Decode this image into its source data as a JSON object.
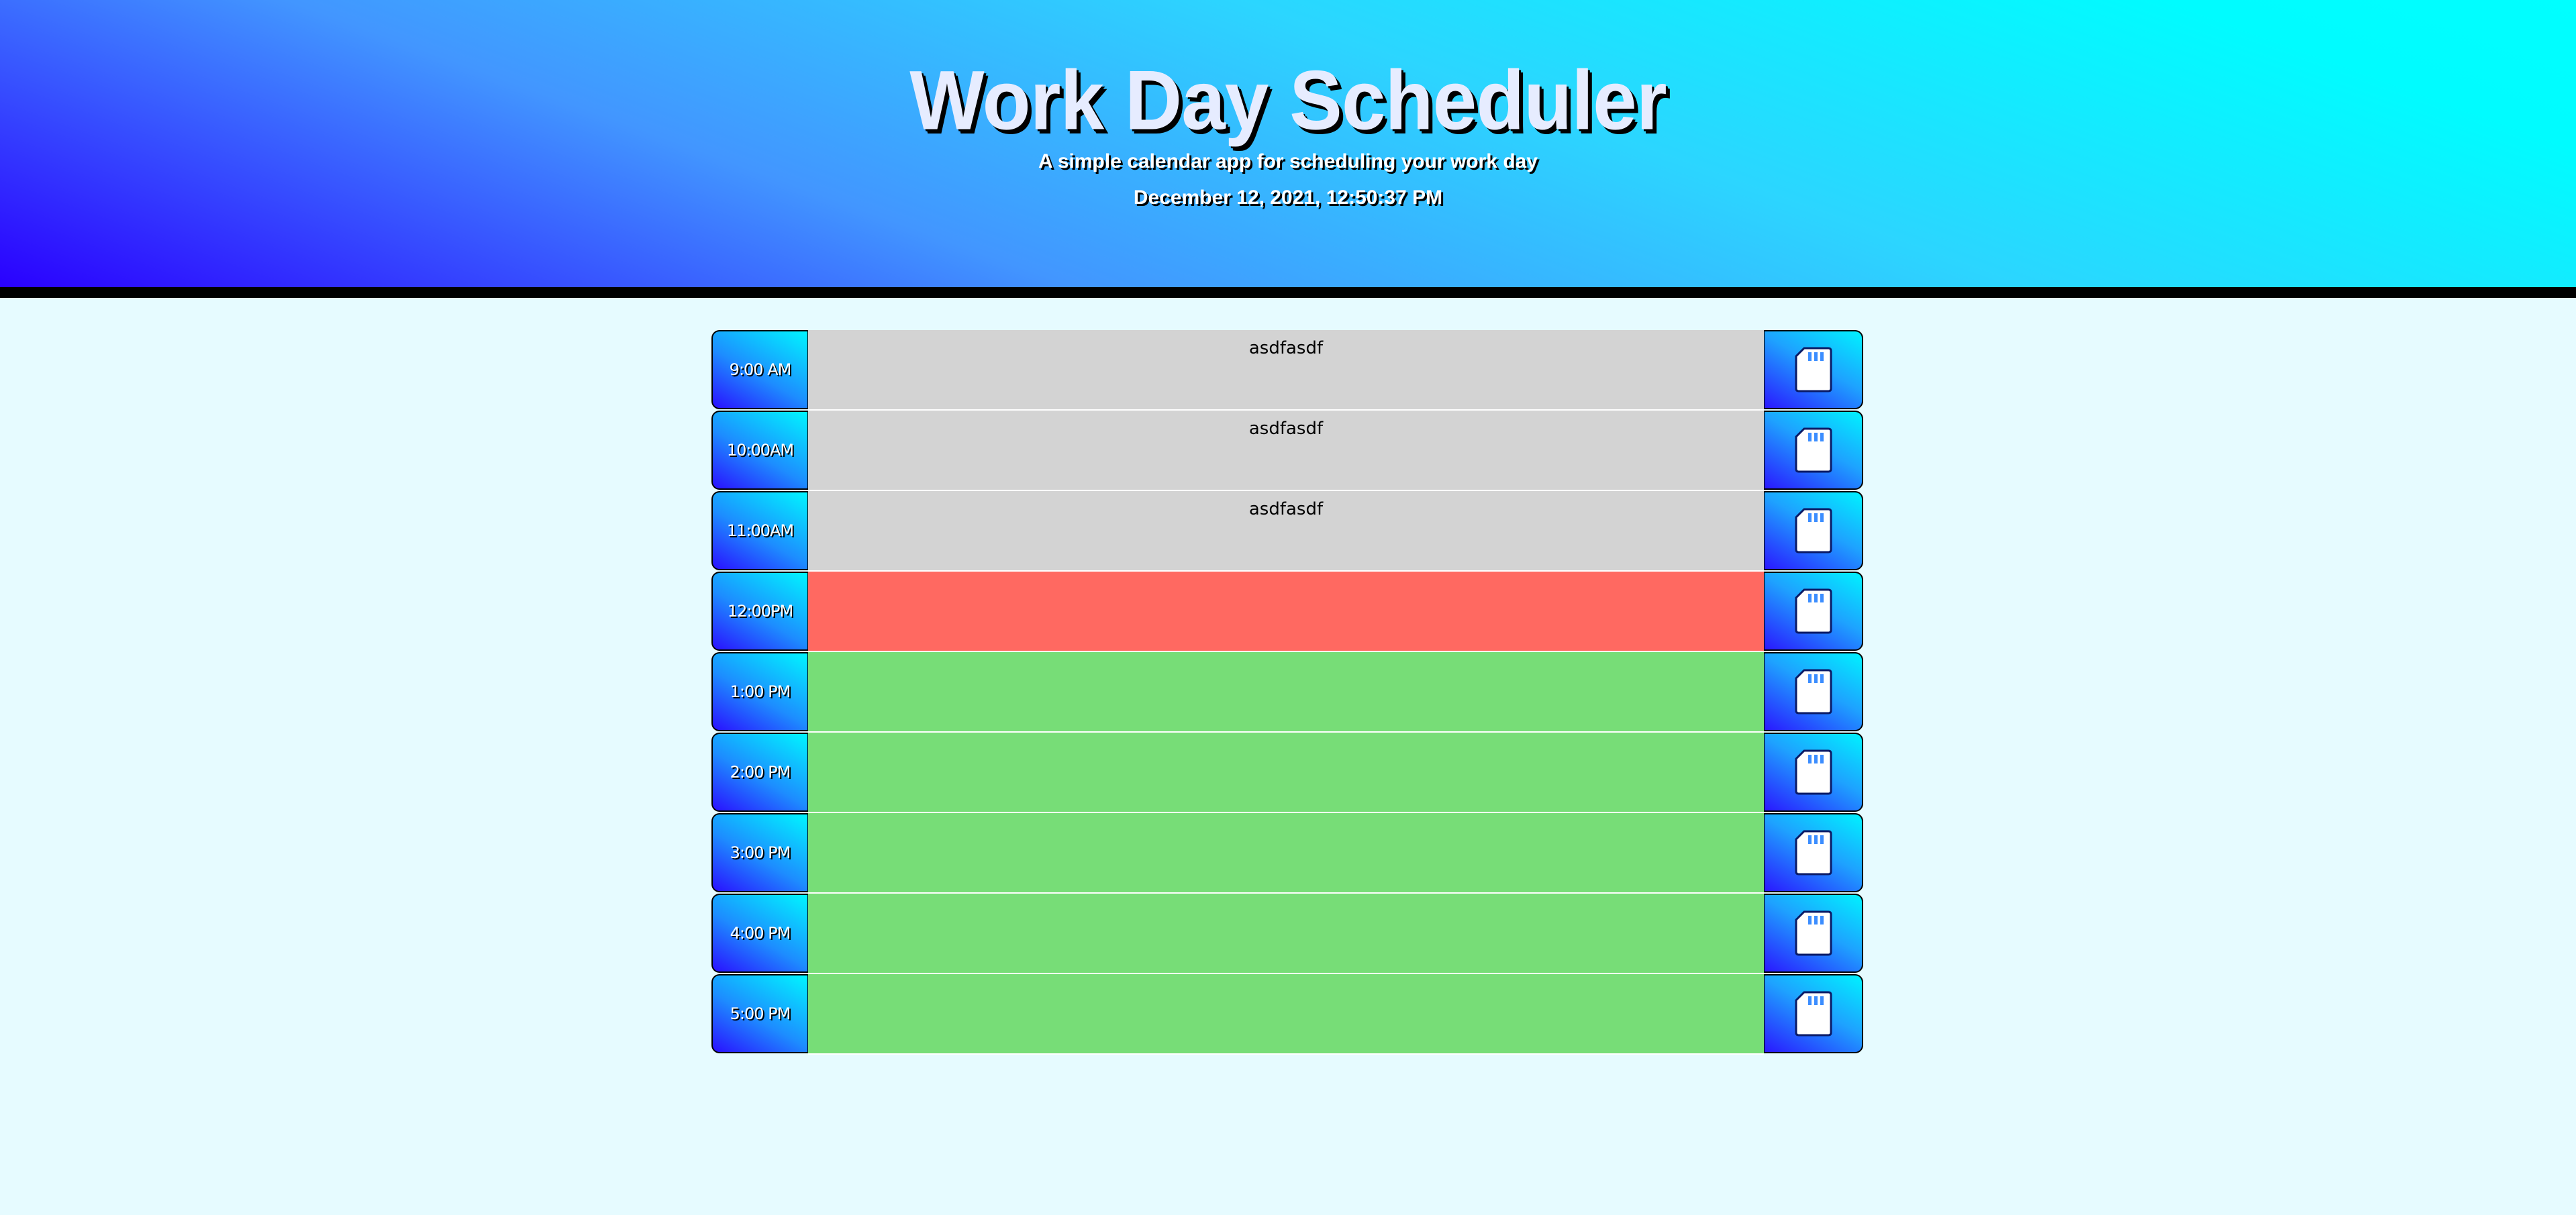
{
  "header": {
    "title": "Work Day Scheduler",
    "subtitle": "A simple calendar app for scheduling your work day",
    "datetime": "December 12, 2021, 12:50:37 PM"
  },
  "rows": [
    {
      "hour": "9:00 AM",
      "text": "asdfasdf",
      "status": "past"
    },
    {
      "hour": "10:00AM",
      "text": "asdfasdf",
      "status": "past"
    },
    {
      "hour": "11:00AM",
      "text": "asdfasdf",
      "status": "past"
    },
    {
      "hour": "12:00PM",
      "text": "",
      "status": "present"
    },
    {
      "hour": "1:00 PM",
      "text": "",
      "status": "future"
    },
    {
      "hour": "2:00 PM",
      "text": "",
      "status": "future"
    },
    {
      "hour": "3:00 PM",
      "text": "",
      "status": "future"
    },
    {
      "hour": "4:00 PM",
      "text": "",
      "status": "future"
    },
    {
      "hour": "5:00 PM",
      "text": "",
      "status": "future"
    }
  ],
  "icons": {
    "save": "save-icon"
  },
  "colors": {
    "past": "#d3d3d3",
    "present": "#ff6961",
    "future": "#77dd77",
    "background": "#e6fbff"
  }
}
